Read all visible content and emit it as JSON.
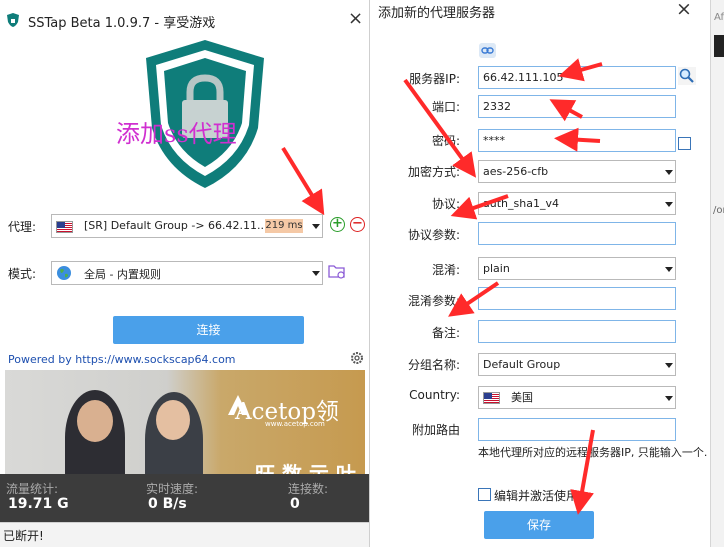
{
  "left_window": {
    "title": "SSTap Beta 1.0.9.7 - 享受游戏",
    "close_glyph": "×",
    "overlay_text": "添加ss代理",
    "proxy": {
      "label": "代理:",
      "value": "[SR] Default Group -> 66.42.11...",
      "latency": "219 ms",
      "add_glyph": "+",
      "remove_glyph": "−"
    },
    "mode": {
      "label": "模式:",
      "value": "全局 - 内置规则"
    },
    "connect_label": "连接",
    "powered_by": "Powered by https://www.sockscap64.com",
    "banner": {
      "brand": "Acetop领",
      "url": "www.acetop.com",
      "bottom_text": "旺 数 示 叶"
    },
    "stats": {
      "traffic_label": "流量统计:",
      "traffic_value": "19.71 G",
      "speed_label": "实时速度:",
      "speed_value": "0 B/s",
      "connections_label": "连接数:",
      "connections_value": "0"
    },
    "status": "已断开!"
  },
  "dialog": {
    "title": "添加新的代理服务器",
    "close_glyph": "×",
    "fields": {
      "server_ip": {
        "label": "服务器IP:",
        "value": "66.42.111.105"
      },
      "port": {
        "label": "端口:",
        "value": "2332"
      },
      "password": {
        "label": "密码:",
        "value": "****"
      },
      "encryption": {
        "label": "加密方式:",
        "value": "aes-256-cfb"
      },
      "protocol": {
        "label": "协议:",
        "value": "auth_sha1_v4"
      },
      "protocol_param": {
        "label": "协议参数:",
        "value": ""
      },
      "obfs": {
        "label": "混淆:",
        "value": "plain"
      },
      "obfs_param": {
        "label": "混淆参数:",
        "value": ""
      },
      "remark": {
        "label": "备注:",
        "value": ""
      },
      "group": {
        "label": "分组名称:",
        "value": "Default Group"
      },
      "country": {
        "label": "Country:",
        "value": "美国"
      },
      "extra_route": {
        "label": "附加路由",
        "value": ""
      }
    },
    "route_hint": "本地代理所对应的远程服务器IP, 只能输入一个.",
    "activate_label": "编辑并激活使用",
    "save_label": "保存"
  },
  "background_window": {
    "text_top": "Af",
    "text_mid": "/or"
  },
  "colors": {
    "accent": "#4aa0ea",
    "annotation_red": "#ff2a2a",
    "overlay_magenta": "#d02fd0",
    "shield_teal": "#0f7d7a",
    "stats_bg": "#3c3c3c"
  }
}
